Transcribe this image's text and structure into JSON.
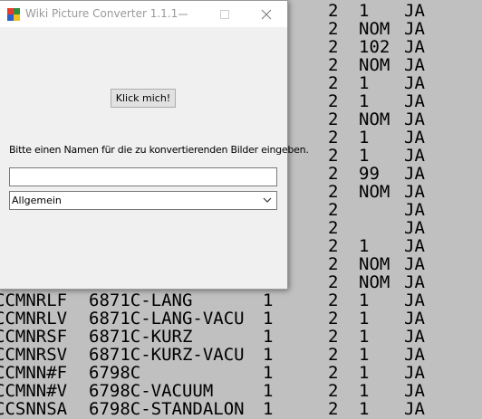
{
  "window": {
    "title": "Wiki Picture Converter 1.1.1",
    "minimize_glyph": "—",
    "maximize_glyph": "☐",
    "close_glyph": "✕"
  },
  "form": {
    "button_label": "Klick mich!",
    "instruction": "Bitte einen Namen für die zu konvertierenden Bilder eingeben.",
    "name_value": "",
    "select_value": "Allgemein"
  },
  "terminal_rows": [
    {
      "code": "",
      "name": "",
      "one": "",
      "two": "2",
      "val": "1",
      "ja": "JA"
    },
    {
      "code": "",
      "name": "",
      "one": "",
      "two": "2",
      "val": "NOM",
      "ja": "JA"
    },
    {
      "code": "",
      "name": "",
      "one": "",
      "two": "2",
      "val": "102",
      "ja": "JA"
    },
    {
      "code": "",
      "name": "",
      "one": "",
      "two": "2",
      "val": "NOM",
      "ja": "JA"
    },
    {
      "code": "",
      "name": "",
      "one": "",
      "two": "2",
      "val": "1",
      "ja": "JA"
    },
    {
      "code": "",
      "name": "",
      "one": "",
      "two": "2",
      "val": "1",
      "ja": "JA"
    },
    {
      "code": "",
      "name": "",
      "one": "",
      "two": "2",
      "val": "NOM",
      "ja": "JA"
    },
    {
      "code": "",
      "name": "",
      "one": "",
      "two": "2",
      "val": "1",
      "ja": "JA"
    },
    {
      "code": "",
      "name": "",
      "one": "",
      "two": "2",
      "val": "1",
      "ja": "JA"
    },
    {
      "code": "",
      "name": "",
      "one": "",
      "two": "2",
      "val": "99",
      "ja": "JA"
    },
    {
      "code": "",
      "name": "",
      "one": "",
      "two": "2",
      "val": "NOM",
      "ja": "JA"
    },
    {
      "code": "",
      "name": "",
      "one": "",
      "two": "2",
      "val": "",
      "ja": "JA"
    },
    {
      "code": "",
      "name": "",
      "one": "",
      "two": "2",
      "val": "",
      "ja": "JA"
    },
    {
      "code": "",
      "name": "",
      "one": "",
      "two": "2",
      "val": "1",
      "ja": "JA"
    },
    {
      "code": "",
      "name": "",
      "one": "",
      "two": "2",
      "val": "NOM",
      "ja": "JA"
    },
    {
      "code": "",
      "name": "",
      "one": "",
      "two": "2",
      "val": "NOM",
      "ja": "JA"
    },
    {
      "code": "CCMNRLF",
      "name": "6871C-LANG",
      "one": "1",
      "two": "2",
      "val": "1",
      "ja": "JA"
    },
    {
      "code": "CCMNRLV",
      "name": "6871C-LANG-VACU",
      "one": "1",
      "two": "2",
      "val": "1",
      "ja": "JA"
    },
    {
      "code": "CCMNRSF",
      "name": "6871C-KURZ",
      "one": "1",
      "two": "2",
      "val": "1",
      "ja": "JA"
    },
    {
      "code": "CCMNRSV",
      "name": "6871C-KURZ-VACU",
      "one": "1",
      "two": "2",
      "val": "1",
      "ja": "JA"
    },
    {
      "code": "CCMNN#F",
      "name": "6798C",
      "one": "1",
      "two": "2",
      "val": "1",
      "ja": "JA"
    },
    {
      "code": "CCMNN#V",
      "name": "6798C-VACUUM",
      "one": "1",
      "two": "2",
      "val": "1",
      "ja": "JA"
    },
    {
      "code": "CCSNNSA",
      "name": "6798C-STANDALON",
      "one": "1",
      "two": "2",
      "val": "1",
      "ja": "JA"
    }
  ]
}
